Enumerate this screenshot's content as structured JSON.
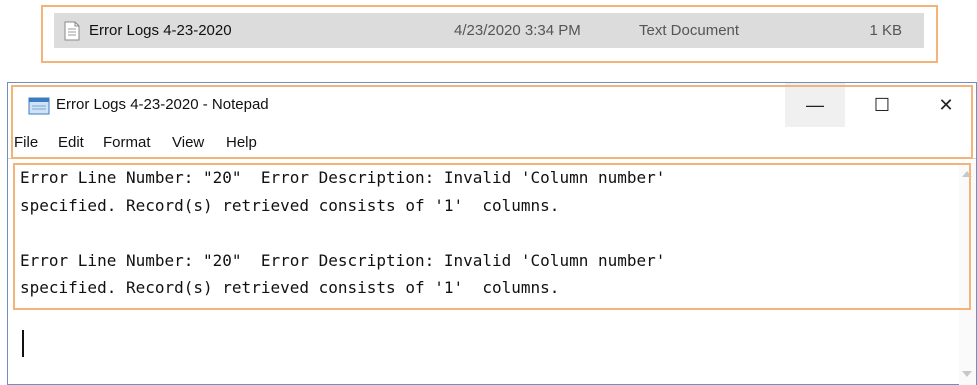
{
  "explorer": {
    "file": {
      "name": "Error Logs 4-23-2020",
      "date_modified": "4/23/2020 3:34 PM",
      "type": "Text Document",
      "size": "1 KB",
      "icon": "text-file-icon"
    }
  },
  "notepad": {
    "title": "Error Logs 4-23-2020 - Notepad",
    "window_controls": {
      "minimize": "—",
      "maximize": "☐",
      "close": "✕"
    },
    "menu": [
      "File",
      "Edit",
      "Format",
      "View",
      "Help"
    ],
    "lines": [
      "Error Line Number: \"20\"  Error Description: Invalid 'Column number'",
      "specified. Record(s) retrieved consists of '1'  columns.",
      "",
      "Error Line Number: \"20\"  Error Description: Invalid 'Column number'",
      "specified. Record(s) retrieved consists of '1'  columns."
    ]
  },
  "colors": {
    "highlight_border": "#f3b47a",
    "window_border": "#6e8fc6",
    "selected_row": "#dcdcdc"
  }
}
